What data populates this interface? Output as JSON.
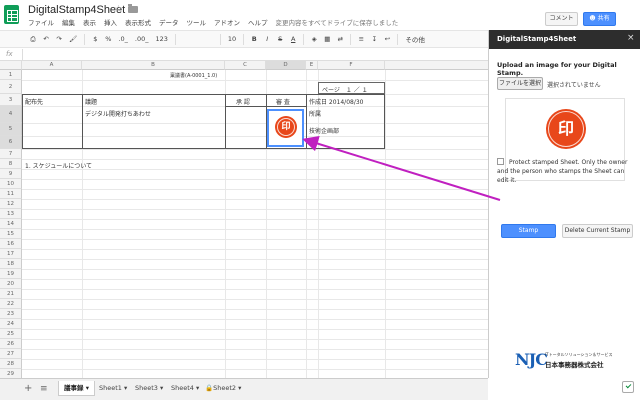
{
  "app": {
    "doc_title": "DigitalStamp4Sheet",
    "user_email": "",
    "comment_label": "コメント",
    "share_label": "共有"
  },
  "menu": {
    "items": [
      "ファイル",
      "編集",
      "表示",
      "挿入",
      "表示形式",
      "データ",
      "ツール",
      "アドオン",
      "ヘルプ"
    ],
    "save_status": "変更内容をすべてドライブに保存しました"
  },
  "toolbar": {
    "currency": "$",
    "percent": "%",
    "dec_less": ".0_",
    "dec_more": ".00_",
    "format_more": "123",
    "font_name": "",
    "font_size": "10",
    "bold": "B",
    "italic": "I",
    "strike": "S",
    "text_color": "A",
    "more": "その他"
  },
  "formula": {
    "fx": "fx",
    "value": ""
  },
  "grid": {
    "columns": [
      "A",
      "B",
      "C",
      "D",
      "E",
      "F"
    ],
    "rows": [
      "1",
      "2",
      "3",
      "4",
      "5",
      "6",
      "7",
      "8",
      "9",
      "10",
      "11",
      "12",
      "13",
      "14",
      "15",
      "16",
      "17",
      "18",
      "19",
      "20",
      "21",
      "22",
      "23",
      "24",
      "25",
      "26",
      "27",
      "28",
      "29",
      "30"
    ],
    "doc_number": "稟議書(A-0001_1.0)",
    "page": "ページ　１ ／ １",
    "distribution": "配布先",
    "subject_label": "議題",
    "subject_value": "デジタル開発打ちあわせ",
    "approval": "承 認",
    "review": "審 査",
    "date": "作成日 2014/08/30",
    "author_label": "所属",
    "author_value": "技術企画部",
    "item_1": "1. スケジュールについて"
  },
  "tabs": [
    {
      "label": "議事録",
      "active": true
    },
    {
      "label": "Sheet1",
      "active": false
    },
    {
      "label": "Sheet3",
      "active": false
    },
    {
      "label": "Sheet4",
      "active": false
    },
    {
      "label": "Sheet2",
      "active": false
    }
  ],
  "sidebar": {
    "title": "DigitalStamp4Sheet",
    "close": "×",
    "instruction": "Upload an image for your Digital Stamp.",
    "choose_file": "ファイルを選択",
    "no_file": "選択されていません",
    "protect_text": "Protect stamped Sheet. Only the owner and the person who stamps the Sheet can edit it.",
    "stamp_button": "Stamp",
    "delete_button": "Delete Current Stamp",
    "logo_mark": "NJC",
    "logo_tagline": "ITトータルソリューション＆サービス",
    "logo_company": "日本事務器株式会社"
  },
  "colors": {
    "accent": "#4d90fe",
    "sheets_green": "#0f9d58",
    "stamp_red": "#e8471a",
    "arrow": "#c020c0"
  },
  "icons": {
    "star": "star-icon",
    "folder": "folder-icon",
    "print": "print-icon",
    "undo": "undo-icon",
    "redo": "redo-icon",
    "paint_format": "paint-format-icon",
    "fill_color": "fill-color-icon",
    "borders": "borders-icon",
    "merge": "merge-icon",
    "align": "align-icon",
    "add_sheet": "add-icon",
    "sheet_list": "menu-icon",
    "explore": "explore-icon"
  }
}
